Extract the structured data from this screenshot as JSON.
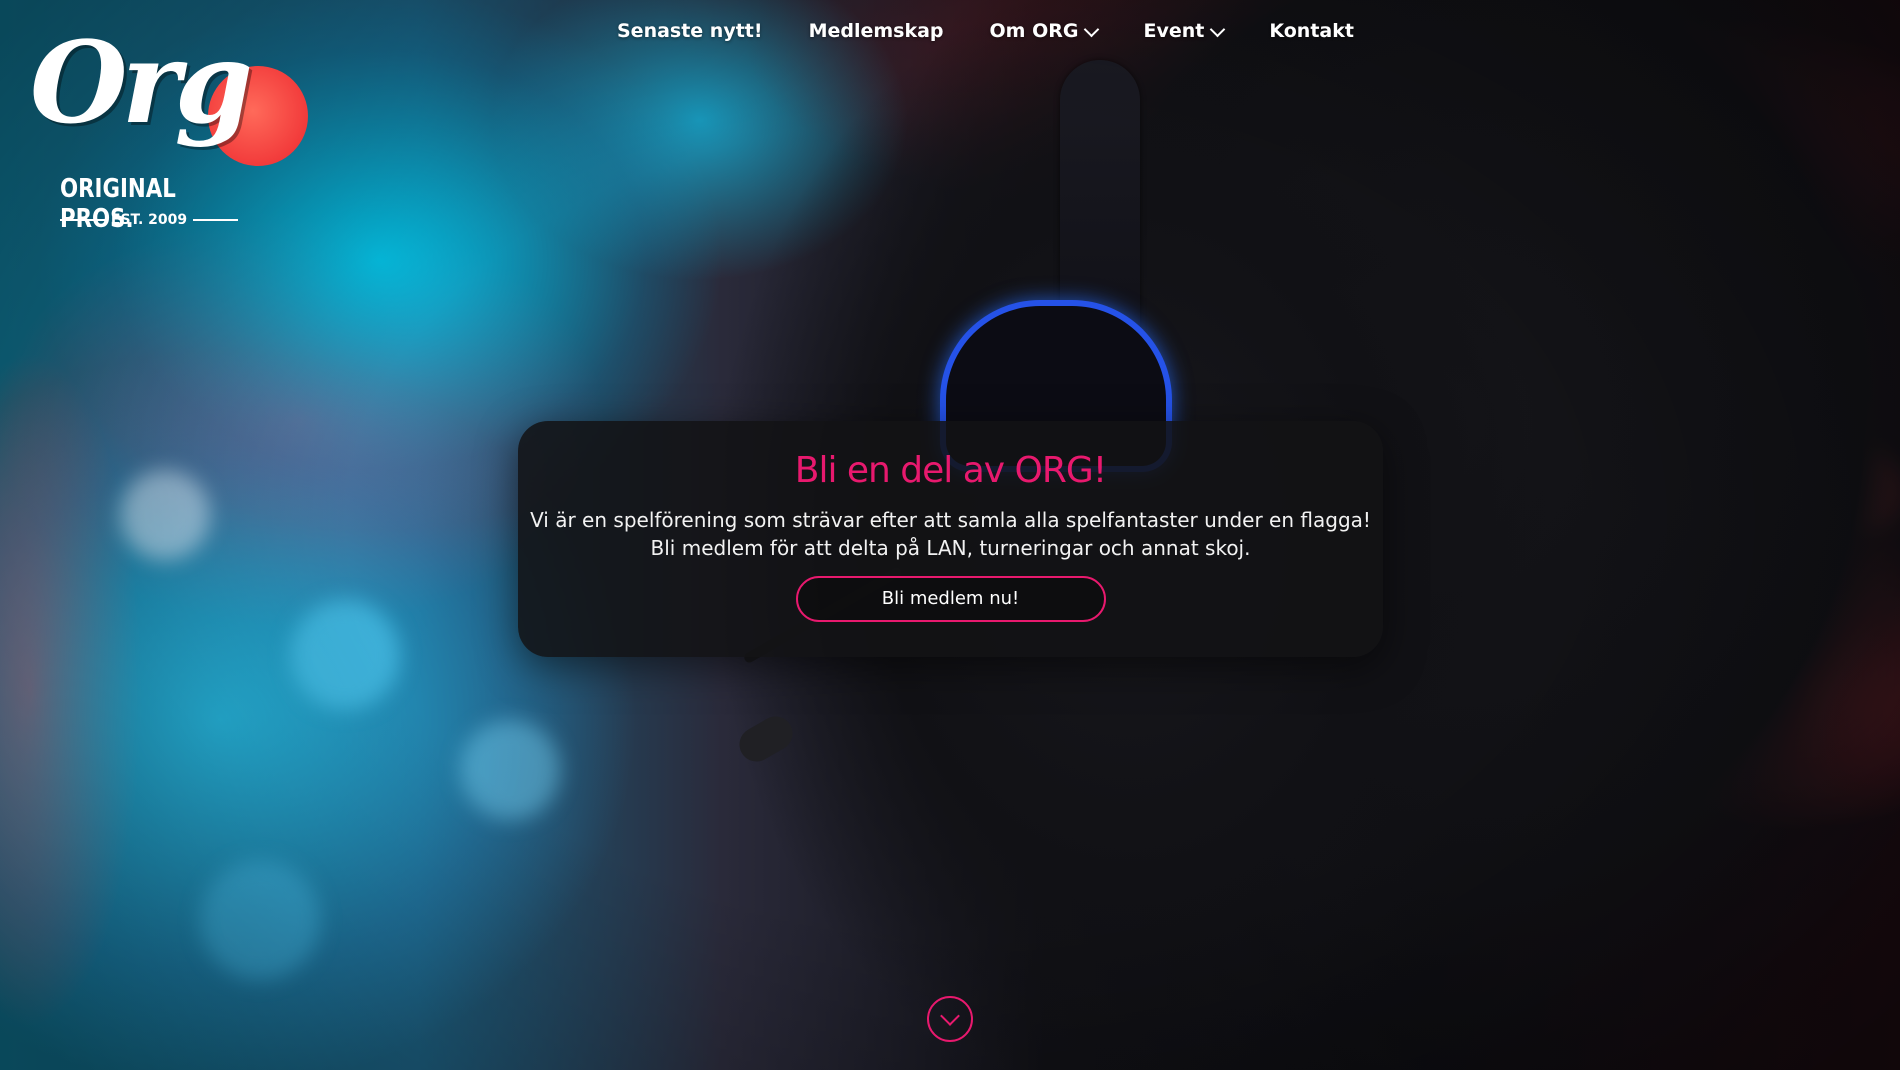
{
  "logo": {
    "script_text": "Org",
    "name": "ORIGINAL PROS.",
    "est": "EST. 2009"
  },
  "nav": {
    "items": [
      {
        "label": "Senaste nytt!",
        "dropdown": false
      },
      {
        "label": "Medlemskap",
        "dropdown": false
      },
      {
        "label": "Om ORG",
        "dropdown": true
      },
      {
        "label": "Event",
        "dropdown": true
      },
      {
        "label": "Kontakt",
        "dropdown": false
      }
    ]
  },
  "hero": {
    "title": "Bli en del av ORG!",
    "line1": "Vi är en spelförening som strävar efter att samla alla spelfantaster under en flagga!",
    "line2": "Bli medlem för att delta på LAN, turneringar och annat skoj.",
    "cta_label": "Bli medlem nu!"
  },
  "colors": {
    "accent": "#e8196e",
    "card_bg": "#121214",
    "logo_sun": "#f23b3b"
  },
  "icons": {
    "scroll": "chevron-down-icon",
    "dropdown": "chevron-down-icon"
  }
}
